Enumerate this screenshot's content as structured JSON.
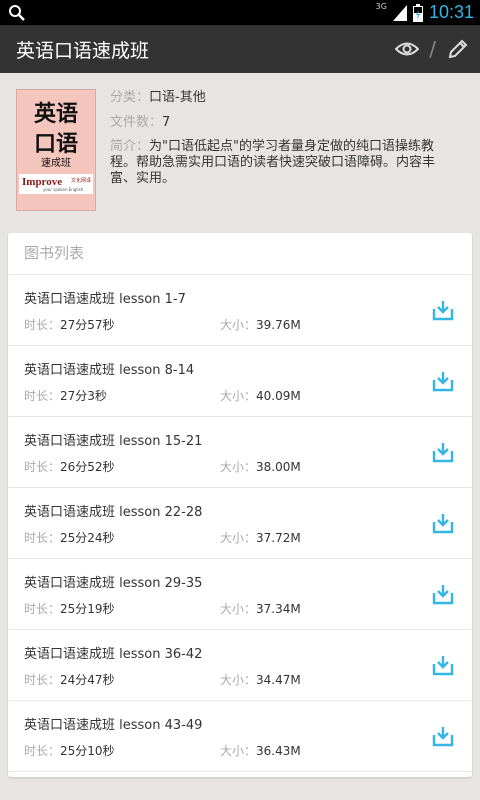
{
  "status_bar": {
    "network": "3G",
    "time": "10:31"
  },
  "action_bar": {
    "title": "英语口语速成班",
    "separator": "/"
  },
  "book": {
    "cover": {
      "line1": "英语",
      "line2": "口语",
      "line3": "速成班",
      "brand": "Improve",
      "brand_cn": "文化网译",
      "brand_en": "your spoken English"
    },
    "category_label": "分类：",
    "category_value": "口语-其他",
    "file_count_label": "文件数：",
    "file_count_value": "7",
    "intro_label": "简介：",
    "intro_text": "为\"口语低起点\"的学习者量身定做的纯口语操练教程。帮助急需实用口语的读者快速突破口语障碍。内容丰富、实用。"
  },
  "list": {
    "title": "图书列表",
    "duration_label": "时长：",
    "size_label": "大小：",
    "items": [
      {
        "name": "英语口语速成班 lesson 1-7",
        "duration": "27分57秒",
        "size": "39.76M"
      },
      {
        "name": "英语口语速成班 lesson 8-14",
        "duration": "27分3秒",
        "size": "40.09M"
      },
      {
        "name": "英语口语速成班 lesson 15-21",
        "duration": "26分52秒",
        "size": "38.00M"
      },
      {
        "name": "英语口语速成班 lesson 22-28",
        "duration": "25分24秒",
        "size": "37.72M"
      },
      {
        "name": "英语口语速成班 lesson 29-35",
        "duration": "25分19秒",
        "size": "37.34M"
      },
      {
        "name": "英语口语速成班 lesson 36-42",
        "duration": "24分47秒",
        "size": "34.47M"
      },
      {
        "name": "英语口语速成班 lesson 43-49",
        "duration": "25分10秒",
        "size": "36.43M"
      }
    ]
  },
  "colors": {
    "accent": "#33b5e5",
    "action_bar": "#333333",
    "background": "#e8e4e4"
  }
}
